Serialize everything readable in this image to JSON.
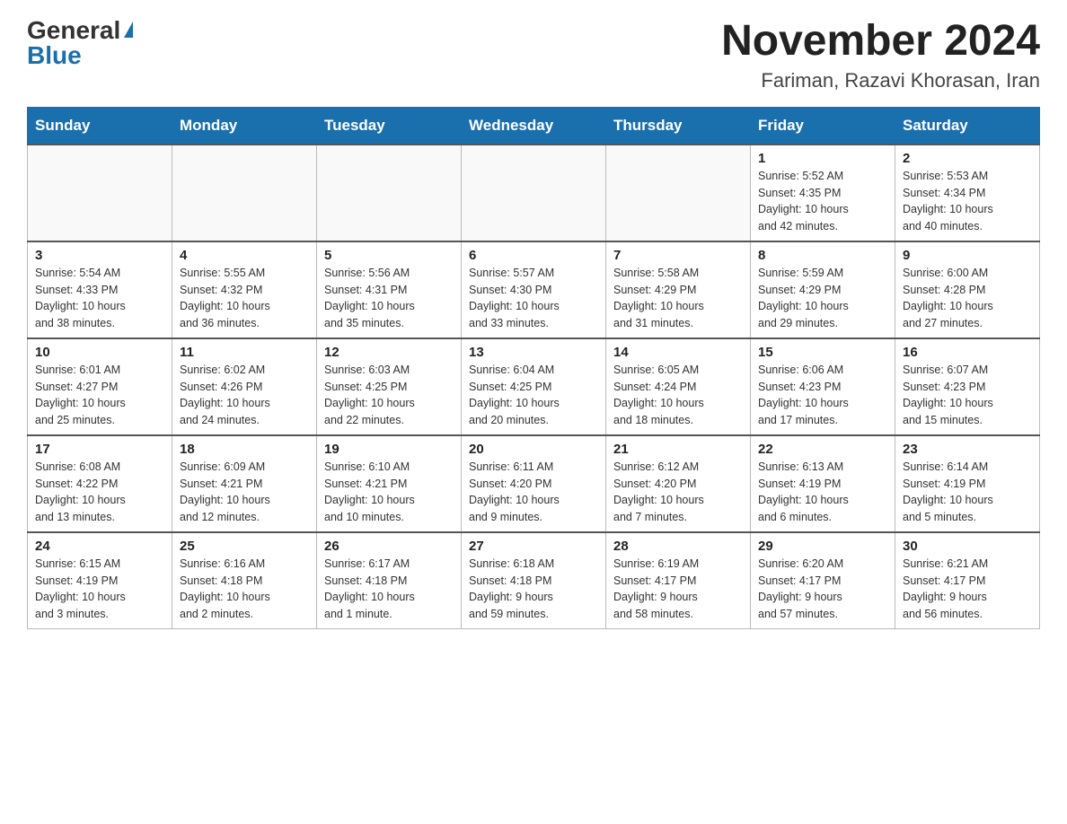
{
  "logo": {
    "general": "General",
    "blue": "Blue"
  },
  "header": {
    "month_title": "November 2024",
    "location": "Fariman, Razavi Khorasan, Iran"
  },
  "days_of_week": [
    "Sunday",
    "Monday",
    "Tuesday",
    "Wednesday",
    "Thursday",
    "Friday",
    "Saturday"
  ],
  "weeks": [
    [
      {
        "day": "",
        "info": ""
      },
      {
        "day": "",
        "info": ""
      },
      {
        "day": "",
        "info": ""
      },
      {
        "day": "",
        "info": ""
      },
      {
        "day": "",
        "info": ""
      },
      {
        "day": "1",
        "info": "Sunrise: 5:52 AM\nSunset: 4:35 PM\nDaylight: 10 hours\nand 42 minutes."
      },
      {
        "day": "2",
        "info": "Sunrise: 5:53 AM\nSunset: 4:34 PM\nDaylight: 10 hours\nand 40 minutes."
      }
    ],
    [
      {
        "day": "3",
        "info": "Sunrise: 5:54 AM\nSunset: 4:33 PM\nDaylight: 10 hours\nand 38 minutes."
      },
      {
        "day": "4",
        "info": "Sunrise: 5:55 AM\nSunset: 4:32 PM\nDaylight: 10 hours\nand 36 minutes."
      },
      {
        "day": "5",
        "info": "Sunrise: 5:56 AM\nSunset: 4:31 PM\nDaylight: 10 hours\nand 35 minutes."
      },
      {
        "day": "6",
        "info": "Sunrise: 5:57 AM\nSunset: 4:30 PM\nDaylight: 10 hours\nand 33 minutes."
      },
      {
        "day": "7",
        "info": "Sunrise: 5:58 AM\nSunset: 4:29 PM\nDaylight: 10 hours\nand 31 minutes."
      },
      {
        "day": "8",
        "info": "Sunrise: 5:59 AM\nSunset: 4:29 PM\nDaylight: 10 hours\nand 29 minutes."
      },
      {
        "day": "9",
        "info": "Sunrise: 6:00 AM\nSunset: 4:28 PM\nDaylight: 10 hours\nand 27 minutes."
      }
    ],
    [
      {
        "day": "10",
        "info": "Sunrise: 6:01 AM\nSunset: 4:27 PM\nDaylight: 10 hours\nand 25 minutes."
      },
      {
        "day": "11",
        "info": "Sunrise: 6:02 AM\nSunset: 4:26 PM\nDaylight: 10 hours\nand 24 minutes."
      },
      {
        "day": "12",
        "info": "Sunrise: 6:03 AM\nSunset: 4:25 PM\nDaylight: 10 hours\nand 22 minutes."
      },
      {
        "day": "13",
        "info": "Sunrise: 6:04 AM\nSunset: 4:25 PM\nDaylight: 10 hours\nand 20 minutes."
      },
      {
        "day": "14",
        "info": "Sunrise: 6:05 AM\nSunset: 4:24 PM\nDaylight: 10 hours\nand 18 minutes."
      },
      {
        "day": "15",
        "info": "Sunrise: 6:06 AM\nSunset: 4:23 PM\nDaylight: 10 hours\nand 17 minutes."
      },
      {
        "day": "16",
        "info": "Sunrise: 6:07 AM\nSunset: 4:23 PM\nDaylight: 10 hours\nand 15 minutes."
      }
    ],
    [
      {
        "day": "17",
        "info": "Sunrise: 6:08 AM\nSunset: 4:22 PM\nDaylight: 10 hours\nand 13 minutes."
      },
      {
        "day": "18",
        "info": "Sunrise: 6:09 AM\nSunset: 4:21 PM\nDaylight: 10 hours\nand 12 minutes."
      },
      {
        "day": "19",
        "info": "Sunrise: 6:10 AM\nSunset: 4:21 PM\nDaylight: 10 hours\nand 10 minutes."
      },
      {
        "day": "20",
        "info": "Sunrise: 6:11 AM\nSunset: 4:20 PM\nDaylight: 10 hours\nand 9 minutes."
      },
      {
        "day": "21",
        "info": "Sunrise: 6:12 AM\nSunset: 4:20 PM\nDaylight: 10 hours\nand 7 minutes."
      },
      {
        "day": "22",
        "info": "Sunrise: 6:13 AM\nSunset: 4:19 PM\nDaylight: 10 hours\nand 6 minutes."
      },
      {
        "day": "23",
        "info": "Sunrise: 6:14 AM\nSunset: 4:19 PM\nDaylight: 10 hours\nand 5 minutes."
      }
    ],
    [
      {
        "day": "24",
        "info": "Sunrise: 6:15 AM\nSunset: 4:19 PM\nDaylight: 10 hours\nand 3 minutes."
      },
      {
        "day": "25",
        "info": "Sunrise: 6:16 AM\nSunset: 4:18 PM\nDaylight: 10 hours\nand 2 minutes."
      },
      {
        "day": "26",
        "info": "Sunrise: 6:17 AM\nSunset: 4:18 PM\nDaylight: 10 hours\nand 1 minute."
      },
      {
        "day": "27",
        "info": "Sunrise: 6:18 AM\nSunset: 4:18 PM\nDaylight: 9 hours\nand 59 minutes."
      },
      {
        "day": "28",
        "info": "Sunrise: 6:19 AM\nSunset: 4:17 PM\nDaylight: 9 hours\nand 58 minutes."
      },
      {
        "day": "29",
        "info": "Sunrise: 6:20 AM\nSunset: 4:17 PM\nDaylight: 9 hours\nand 57 minutes."
      },
      {
        "day": "30",
        "info": "Sunrise: 6:21 AM\nSunset: 4:17 PM\nDaylight: 9 hours\nand 56 minutes."
      }
    ]
  ]
}
